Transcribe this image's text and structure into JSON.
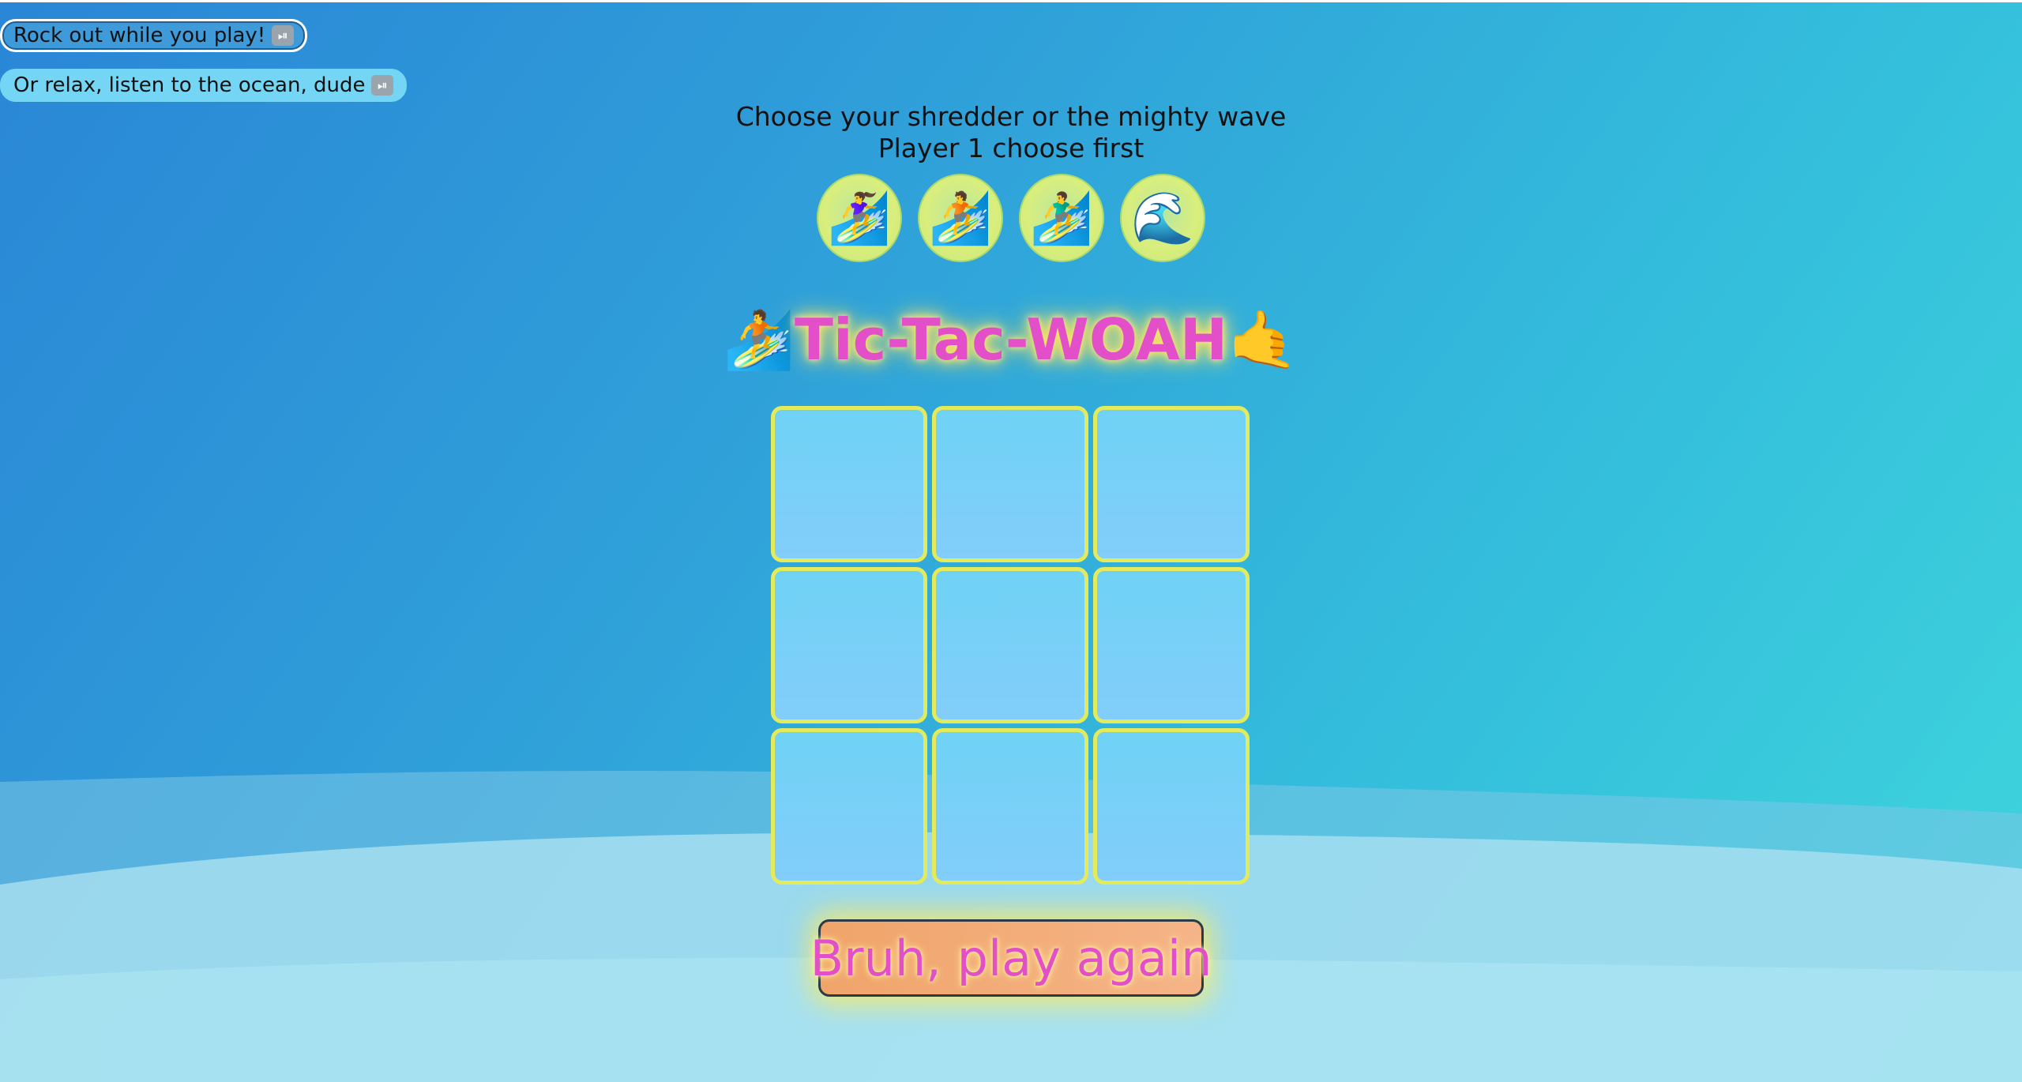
{
  "music": {
    "rock_label": "Rock out while you play!",
    "ocean_label": "Or relax, listen to the ocean, dude",
    "toggle_glyph": "⏯"
  },
  "chooser": {
    "prompt": "Choose your shredder or the mighty wave",
    "turn": "Player 1 choose first",
    "avatars": [
      {
        "icon": "surfer-woman-icon",
        "glyph": "🏄‍♀️"
      },
      {
        "icon": "surfer-icon",
        "glyph": "🏄"
      },
      {
        "icon": "surfer-man-icon",
        "glyph": "🏄‍♂️"
      },
      {
        "icon": "wave-icon",
        "glyph": "🌊"
      }
    ]
  },
  "title": {
    "left_emoji": "🏄",
    "text": "Tic-Tac-WOAH",
    "right_emoji": "🤙"
  },
  "board": {
    "cells": [
      "",
      "",
      "",
      "",
      "",
      "",
      "",
      "",
      ""
    ]
  },
  "play_again_label": "Bruh, play again",
  "colors": {
    "title": "#e24fc9",
    "glow": "#ffe45c",
    "cell_border": "#e3ea5c",
    "cell_fill": "#82cdfa"
  }
}
